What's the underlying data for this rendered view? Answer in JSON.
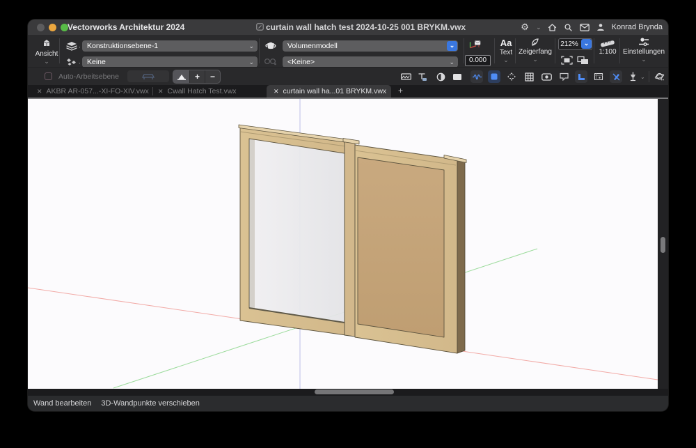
{
  "window": {
    "app_title": "Vectorworks Architektur 2024",
    "document_title": "curtain wall hatch test 2024-10-25 001 BRYKM.vwx",
    "user_name": "Konrad Brynda"
  },
  "toolbar": {
    "view_label": "Ansicht",
    "layer_value": "Konstruktionsebene-1",
    "class_value": "Keine",
    "render_mode_value": "Volumenmodell",
    "saved_view_value": "<Keine>",
    "rotation_value": "0.000",
    "text_label": "Text",
    "text_glyph": "Aa",
    "snap_label": "Zeigerfang",
    "zoom_value": "212%",
    "scale_value": "1:100",
    "settings_label": "Einstellungen"
  },
  "mode_bar": {
    "auto_workplane_label": "Auto-Arbeitsebene",
    "zoom_in": "+",
    "zoom_out": "−"
  },
  "tabs": {
    "items": [
      {
        "label": "AKBR AR-057...-XI-FO-XIV.vwx",
        "active": false
      },
      {
        "label": "Cwall Hatch Test.vwx",
        "active": false
      },
      {
        "label": "curtain wall ha...01 BRYKM.vwx",
        "active": true
      }
    ],
    "new_tab_label": "+"
  },
  "status_bar": {
    "mode": "Wand bearbeiten",
    "hint": "3D-Wandpunkte verschieben"
  },
  "icons": {
    "chevron_down": "⌄",
    "close": "✕",
    "gear": "⚙",
    "contrast": "◐",
    "row2_names": [
      "hatch-display-icon",
      "text-scale-icon",
      "contrast-icon",
      "fill-panel-icon",
      "spring-constraint-icon",
      "blue-square-icon",
      "move-handles-icon",
      "grid-icon",
      "camera-eye-icon",
      "annotation-icon",
      "corner-ruler-icon",
      "viewport-frame-icon",
      "no-pen-icon",
      "plumb-tool-icon",
      "navigation-globe-icon"
    ]
  },
  "colors": {
    "accent_blue": "#3a77e0",
    "wood_front": "#d7be94",
    "wood_cap": "#e6d3ac",
    "wood_side": "#7e6a4c",
    "panel_infill": "#c7a67c",
    "glass": "#eceaee",
    "axis_x": "#f2aaa6",
    "axis_y": "#9bdb9b",
    "axis_z": "#b6b7e4",
    "canvas_bg": "#fcfbfd",
    "traffic_gray": "#5c5c5e",
    "traffic_yellow": "#eba73f",
    "traffic_green": "#58bb47"
  }
}
